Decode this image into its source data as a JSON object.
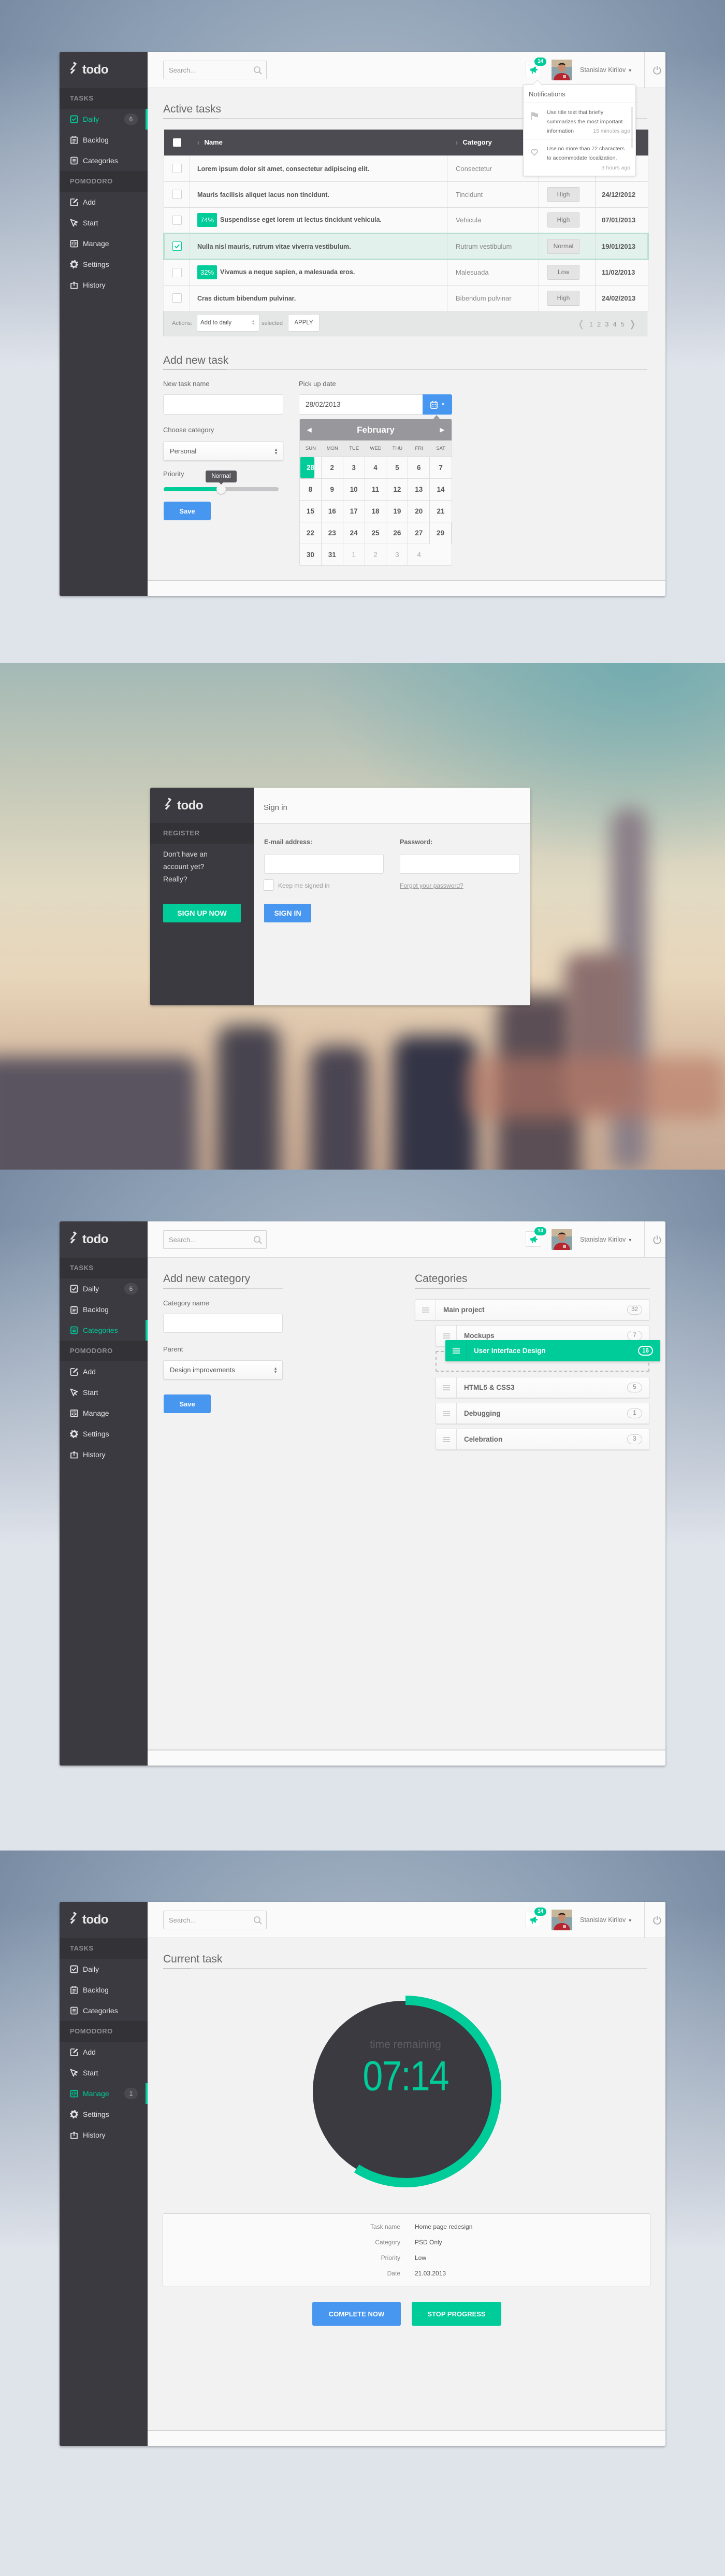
{
  "app": {
    "logo": "todo"
  },
  "colors": {
    "accent_green": "#00cc99",
    "accent_blue": "#4796f0",
    "sidebar": "#3b3a40",
    "sidebar_band": "#333237"
  },
  "header": {
    "search_placeholder": "Search...",
    "search_icon": "search-icon",
    "notification_icon": "megaphone-icon",
    "notification_count": "14",
    "user_name": "Stanislav Kirilov",
    "power_icon": "power-icon"
  },
  "sidebar": {
    "sections": [
      {
        "title": "TASKS",
        "items": [
          {
            "label": "Daily",
            "icon": "checkbox-icon"
          },
          {
            "label": "Backlog",
            "icon": "notepad-icon"
          },
          {
            "label": "Categories",
            "icon": "list-icon"
          }
        ]
      },
      {
        "title": "POMODORO",
        "items": [
          {
            "label": "Add",
            "icon": "edit-icon"
          },
          {
            "label": "Start",
            "icon": "cursor-icon"
          },
          {
            "label": "Manage",
            "icon": "book-icon"
          },
          {
            "label": "Settings",
            "icon": "gear-icon"
          },
          {
            "label": "History",
            "icon": "history-icon"
          }
        ]
      }
    ]
  },
  "active_tasks_screen": {
    "sidebar_active": "Daily",
    "badges": [
      {
        "item": "Daily",
        "count": "6"
      }
    ],
    "title": "Active tasks",
    "table": {
      "columns": [
        "Name",
        "Category",
        "",
        ""
      ],
      "rows": [
        {
          "progress": "",
          "name": "Lorem ipsum dolor sit amet, consectetur adipiscing elit.",
          "category": "Consectetur",
          "priority": "",
          "date": "",
          "checked": false
        },
        {
          "progress": "",
          "name": "Mauris facilisis aliquet lacus non tincidunt.",
          "category": "Tincidunt",
          "priority": "High",
          "date": "24/12/2012",
          "checked": false
        },
        {
          "progress": "74%",
          "name": "Suspendisse eget lorem ut lectus tincidunt vehicula.",
          "category": "Vehicula",
          "priority": "High",
          "date": "07/01/2013",
          "checked": false
        },
        {
          "progress": "",
          "name": "Nulla nisl mauris, rutrum vitae viverra vestibulum.",
          "category": "Rutrum vestibulum",
          "priority": "Normal",
          "date": "19/01/2013",
          "checked": true
        },
        {
          "progress": "32%",
          "name": "Vivamus a neque sapien, a malesuada eros.",
          "category": "Malesuada",
          "priority": "Low",
          "date": "11/02/2013",
          "checked": false
        },
        {
          "progress": "",
          "name": "Cras dictum bibendum pulvinar.",
          "category": "Bibendum pulvinar",
          "priority": "High",
          "date": "24/02/2013",
          "checked": false
        }
      ]
    },
    "actions": {
      "label": "Actions:",
      "selected_action": "Add to daily",
      "suffix": "selected",
      "apply": "APPLY"
    },
    "pagination": {
      "pages": [
        "1",
        "2",
        "3",
        "4",
        "5"
      ]
    },
    "notifications": {
      "title": "Notifications",
      "items": [
        {
          "icon": "flag-icon",
          "text": "Use title text that briefly summarizes the most important information",
          "time": "15 minutes ago"
        },
        {
          "icon": "heart-icon",
          "text": "Use no more than 72 characters to accommodate localization.",
          "time": "3 hours ago"
        }
      ]
    },
    "add_task": {
      "title": "Add new task",
      "name_label": "New task name",
      "name_value": "",
      "date_label": "Pick up date",
      "date_value": "28/02/2013",
      "category_label": "Choose category",
      "category_value": "Personal",
      "priority_label": "Priority",
      "priority_value": "Normal",
      "priority_percent": 50,
      "save": "Save"
    },
    "calendar": {
      "month": "February",
      "weekdays": [
        "SUN",
        "MON",
        "TUE",
        "WED",
        "THU",
        "FRI",
        "SAT"
      ],
      "days": [
        "1",
        "2",
        "3",
        "4",
        "5",
        "6",
        "7",
        "8",
        "9",
        "10",
        "11",
        "12",
        "13",
        "14",
        "15",
        "16",
        "17",
        "18",
        "19",
        "20",
        "21",
        "22",
        "23",
        "24",
        "25",
        "26",
        "27",
        "28",
        "29",
        "30",
        "31",
        "1",
        "2",
        "3",
        "4"
      ],
      "other_month_from_index": 31,
      "selected_day": "28"
    }
  },
  "login_screen": {
    "register_label": "REGISTER",
    "register_text": [
      "Don't have an",
      "account yet?",
      "Really?"
    ],
    "signup_button": "SIGN UP NOW",
    "title": "Sign in",
    "email_label": "E-mail address:",
    "email_value": "",
    "password_label": "Password:",
    "password_value": "",
    "keep_signed_in": "Keep me signed in",
    "keep_signed_in_checked": false,
    "forgot_password": "Forgot your password?",
    "signin_button": "SIGN IN"
  },
  "categories_screen": {
    "sidebar_active": "Categories",
    "badges": [
      {
        "item": "Daily",
        "count": "6"
      }
    ],
    "form_title": "Add new category",
    "name_label": "Category name",
    "name_value": "",
    "parent_label": "Parent",
    "parent_value": "Design improvements",
    "save": "Save",
    "list_title": "Categories",
    "items": [
      {
        "name": "Main project",
        "count": "32",
        "level": 0
      },
      {
        "name": "Mockups",
        "count": "7",
        "level": 1
      },
      {
        "name": "HTML5 & CSS3",
        "count": "5",
        "level": 1
      },
      {
        "name": "Debugging",
        "count": "1",
        "level": 1
      },
      {
        "name": "Celebration",
        "count": "3",
        "level": 1
      }
    ],
    "dragging": {
      "name": "User Interface Design",
      "count": "16"
    }
  },
  "current_task_screen": {
    "sidebar_active": "Manage",
    "badges": [
      {
        "item": "Manage",
        "count": "1"
      }
    ],
    "title": "Current task",
    "timer": {
      "label": "time remaining",
      "value": "07:14",
      "progress_fraction": 0.59
    },
    "details": [
      {
        "key": "Task name",
        "value": "Home page redesign"
      },
      {
        "key": "Category",
        "value": "PSD Only"
      },
      {
        "key": "Priority",
        "value": "Low"
      },
      {
        "key": "Date",
        "value": "21.03.2013"
      }
    ],
    "complete_button": "COMPLETE NOW",
    "stop_button": "STOP PROGRESS"
  }
}
